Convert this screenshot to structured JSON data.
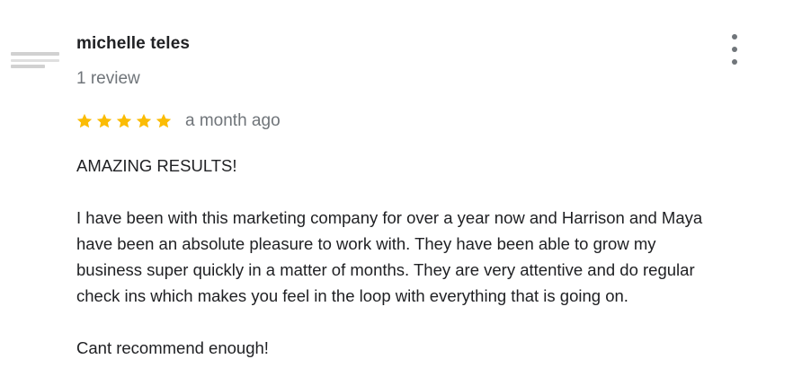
{
  "review": {
    "author": "michelle teles",
    "review_count": "1 review",
    "rating": 5,
    "rating_max": 5,
    "star_color": "#fbbc04",
    "time": "a month ago",
    "headline": "AMAZING RESULTS!",
    "body_lines": [
      "I have been with this marketing company for over a year now and Harrison and Maya",
      "have been an absolute pleasure to work with. They have been able to grow my",
      "business super quickly in a matter of months. They are very attentive and do regular",
      "check ins which makes you feel in the loop with everything that is going on."
    ],
    "closing": "Cant recommend enough!"
  },
  "icons": {
    "more": "more-vert-icon",
    "star": "star-icon"
  }
}
